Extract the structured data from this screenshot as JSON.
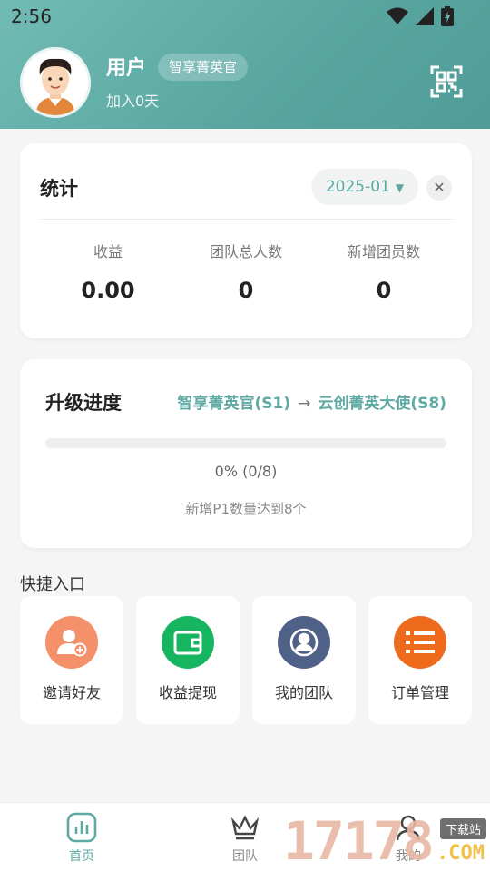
{
  "status_bar": {
    "time": "2:56"
  },
  "profile": {
    "name": "用户",
    "badge": "智享菁英官",
    "join_text": "加入0天"
  },
  "stats": {
    "title": "统计",
    "month": "2025-01",
    "clear_symbol": "✕",
    "items": [
      {
        "label": "收益",
        "value": "0.00"
      },
      {
        "label": "团队总人数",
        "value": "0"
      },
      {
        "label": "新增团员数",
        "value": "0"
      }
    ]
  },
  "upgrade": {
    "title": "升级进度",
    "from_level": "智享菁英官(S1)",
    "arrow": "→",
    "to_level": "云创菁英大使(S8)",
    "progress_fraction": 0,
    "progress_text": "0% (0/8)",
    "hint": "新增P1数量达到8个"
  },
  "shortcuts": {
    "title": "快捷入口",
    "items": [
      {
        "label": "邀请好友",
        "icon": "invite-friend-icon",
        "color": "#f4906a"
      },
      {
        "label": "收益提现",
        "icon": "wallet-icon",
        "color": "#17b55f"
      },
      {
        "label": "我的团队",
        "icon": "team-icon",
        "color": "#4f6187"
      },
      {
        "label": "订单管理",
        "icon": "order-list-icon",
        "color": "#ee6a1d"
      }
    ]
  },
  "tabbar": {
    "items": [
      {
        "label": "首页",
        "icon": "home-chart-icon",
        "active": true
      },
      {
        "label": "团队",
        "icon": "crown-icon",
        "active": false
      },
      {
        "label": "我的",
        "icon": "profile-icon",
        "active": false
      }
    ]
  },
  "watermark": {
    "digits": "17178",
    "tag": "下载站",
    "domain": ".COM"
  },
  "colors": {
    "accent": "#5fa9a3",
    "header_start": "#72bbb5",
    "header_end": "#4f9c98"
  }
}
